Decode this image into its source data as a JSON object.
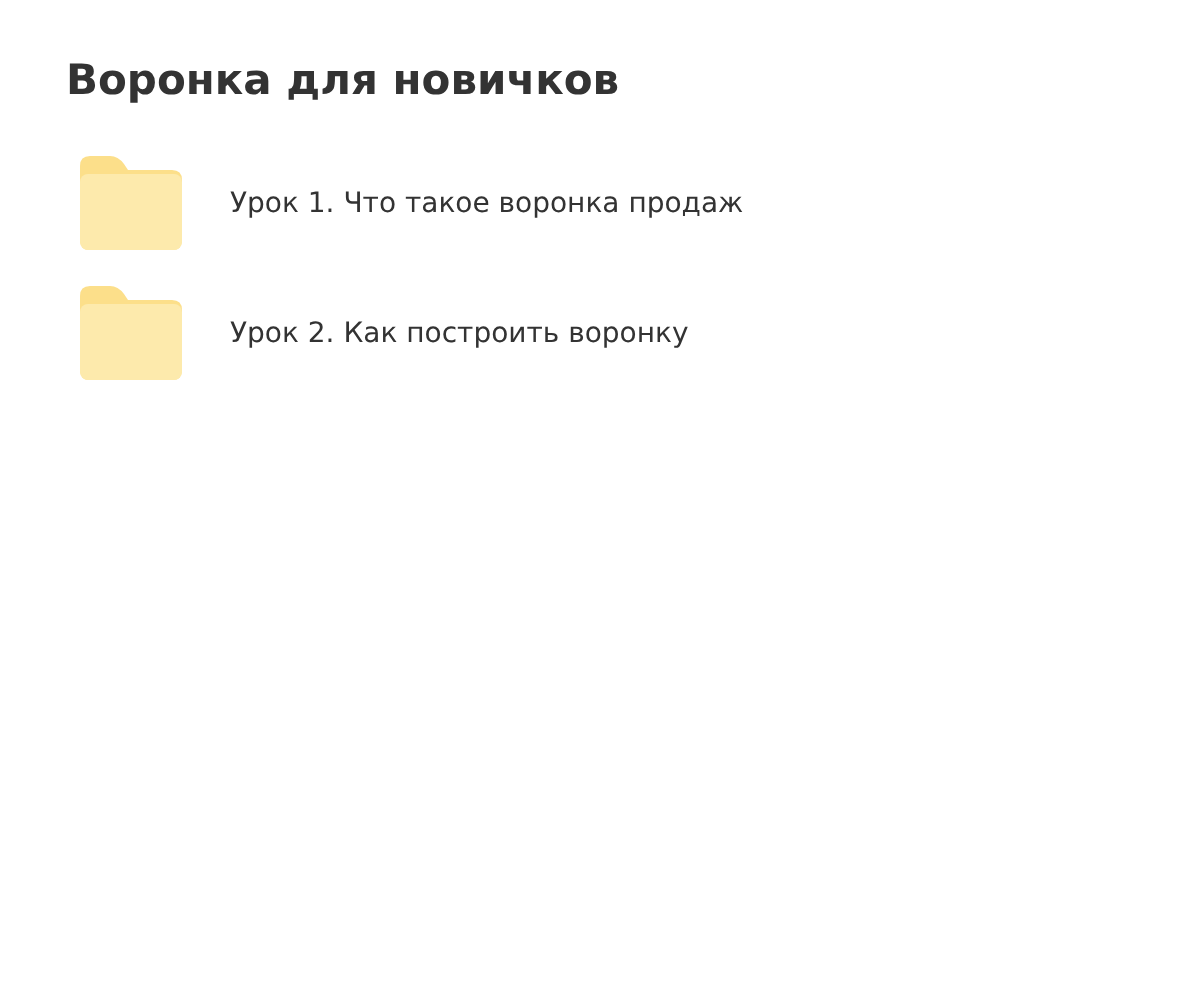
{
  "title": "Воронка для новичков",
  "folders": [
    {
      "name": "Урок 1. Что такое воронка продаж"
    },
    {
      "name": "Урок 2. Как построить воронку"
    }
  ]
}
